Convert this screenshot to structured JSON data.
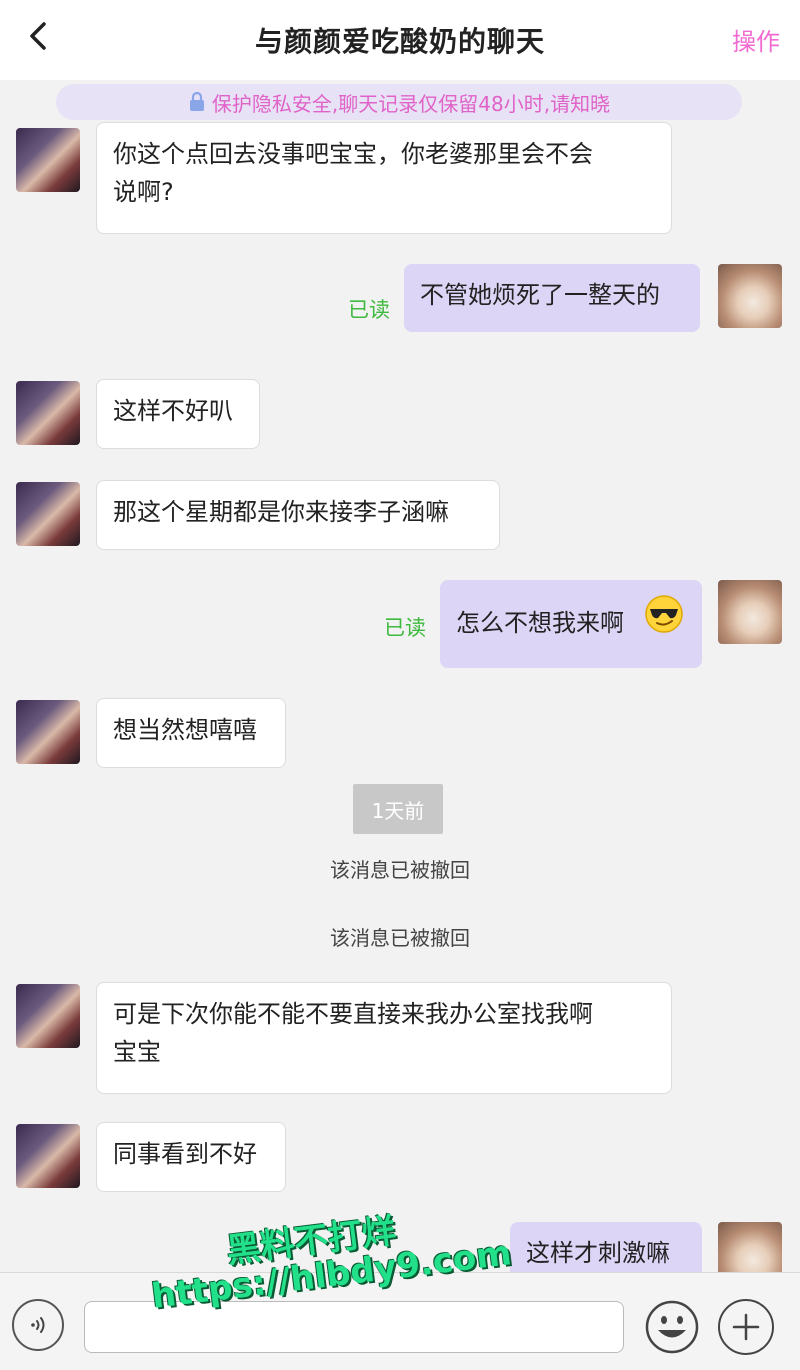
{
  "header": {
    "title": "与颜颜爱吃酸奶的聊天",
    "action_label": "操作"
  },
  "privacy_notice": "保护隐私安全,聊天记录仅保留48小时,请知晓",
  "messages": [
    {
      "from": "her",
      "text_line1": "你这个点回去没事吧宝宝，你老婆那里会不会",
      "text_line2": "说啊?"
    },
    {
      "from": "me",
      "text": "不管她烦死了一整天的",
      "status": "已读"
    },
    {
      "from": "her",
      "text": "这样不好叭"
    },
    {
      "from": "her",
      "text": "那这个星期都是你来接李子涵嘛"
    },
    {
      "from": "me",
      "text": "怎么不想我来啊",
      "status": "已读",
      "emoji": "sunglasses-emoji"
    },
    {
      "from": "her",
      "text": "想当然想嘻嘻"
    },
    {
      "from": "her",
      "text_line1": "可是下次你能不能不要直接来我办公室找我啊",
      "text_line2": "宝宝"
    },
    {
      "from": "her",
      "text": "同事看到不好"
    },
    {
      "from": "me",
      "text": "这样才刺激嘛"
    }
  ],
  "time_divider": "1天前",
  "system_messages": [
    "该消息已被撤回",
    "该消息已被撤回"
  ],
  "input": {
    "placeholder": "",
    "value": ""
  },
  "watermark": {
    "line1": "黑料不打烊",
    "line2": "https://hlbdy9.com"
  },
  "colors": {
    "accent": "#f06ad0",
    "read_status": "#3fb93f",
    "outgoing_bubble": "#ddd5f5",
    "incoming_bubble": "#ffffff"
  }
}
